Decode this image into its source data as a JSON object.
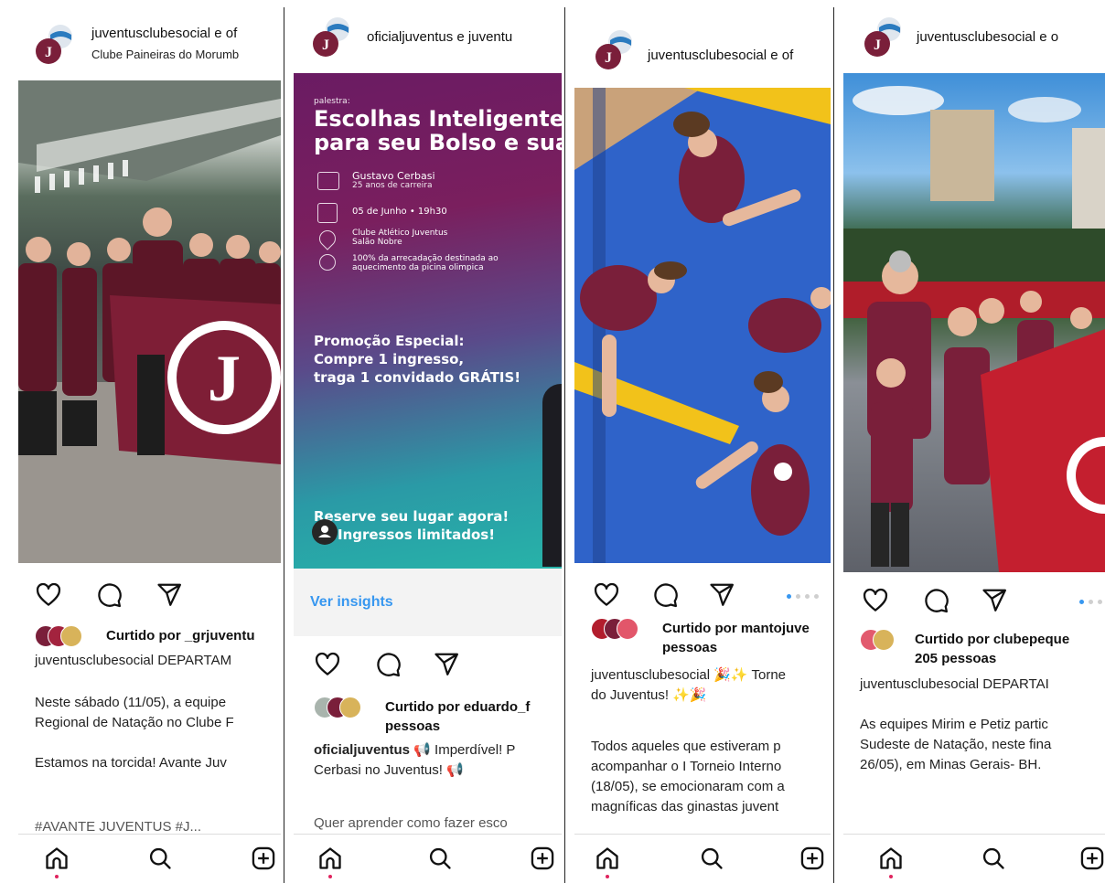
{
  "panels": [
    {
      "account": "juventusclubesocial e of",
      "location": "Clube Paineiras do Morumb",
      "liked_by": "Curtido por _grjuventu",
      "caption_user": "juventusclubesocial",
      "caption_text": "DEPARTAM",
      "body_lines": [
        "Neste sábado (11/05), a equipe",
        "Regional de Natação no Clube F",
        "",
        "Estamos na torcida! Avante Juv"
      ],
      "tail": "#AVANTE JUVENTUS #J..."
    },
    {
      "account": "oficialjuventus e juventu",
      "poster": {
        "kicker": "palestra:",
        "title_1": "Escolhas Inteligentes",
        "title_2": "para seu Bolso e sua V",
        "speaker": "Gustavo Cerbasi",
        "speaker_sub": "25 anos de carreira",
        "date": "05 de Junho • 19h30",
        "venue_1": "Clube Atlético Juventus",
        "venue_2": "Salão Nobre",
        "cause_1": "100% da arrecadação destinada ao",
        "cause_2": "aquecimento da picina olimpica",
        "promo_1": "Promoção Especial:",
        "promo_2": "Compre 1 ingresso,",
        "promo_3": "traga 1 convidado GRÁTIS!",
        "cta_1": "Reserve seu lugar agora!",
        "cta_2": "Ingressos limitados!"
      },
      "insights": "Ver insights",
      "liked_by": "Curtido por eduardo_f",
      "liked_by_2": "pessoas",
      "caption_user": "oficialjuventus",
      "caption_text": "📢 Imperdível! P",
      "caption_text_2": "Cerbasi no Juventus! 📢",
      "tail": "Quer aprender como fazer esco"
    },
    {
      "account": "juventusclubesocial e of",
      "liked_by": "Curtido por mantojuve",
      "liked_by_2": "pessoas",
      "caption_user": "juventusclubesocial",
      "caption_text": "🎉✨ Torne",
      "caption_text_2": "do Juventus! ✨🎉",
      "body_lines": [
        "Todos aqueles que estiveram p",
        "acompanhar o I Torneio Interno",
        "(18/05), se emocionaram com a",
        "magníficas das ginastas juvent"
      ]
    },
    {
      "account": "juventusclubesocial e o",
      "liked_by": "Curtido por clubepeque",
      "liked_by_2": "205 pessoas",
      "caption_user": "juventusclubesocial",
      "caption_text": "DEPARTAI",
      "body_lines": [
        "As equipes Mirim e Petiz partic",
        "Sudeste de Natação, neste fina",
        "26/05), em Minas Gerais- BH."
      ]
    }
  ],
  "colors": {
    "club_maroon": "#7a1f3a",
    "accent_blue": "#3797f0",
    "notification_red": "#e0245e"
  },
  "icons": [
    "heart-icon",
    "comment-icon",
    "share-icon",
    "home-icon",
    "search-icon",
    "create-icon"
  ]
}
